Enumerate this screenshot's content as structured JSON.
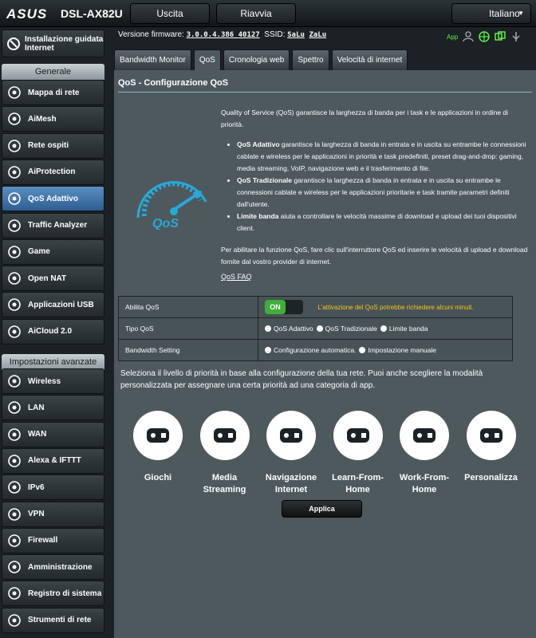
{
  "header": {
    "brand": "ASUS",
    "model": "DSL-AX82U",
    "logout_label": "Uscita",
    "reboot_label": "Riavvia",
    "language": "Italiano"
  },
  "firmware_bar": {
    "firmware_label": "Versione firmware:",
    "firmware_value": "3.0.0.4.386_40127",
    "ssid_label": "SSID:",
    "ssid_1": "SaLu",
    "ssid_2": "ZaLu",
    "app_label": "App"
  },
  "sidebar": {
    "quick_setup": "Installazione guidata Internet",
    "general_header": "Generale",
    "general_items": [
      {
        "label": "Mappa di rete",
        "icon": "network-map-icon"
      },
      {
        "label": "AiMesh",
        "icon": "aimesh-icon"
      },
      {
        "label": "Rete ospiti",
        "icon": "guest-network-icon"
      },
      {
        "label": "AiProtection",
        "icon": "aiprotection-icon"
      },
      {
        "label": "QoS Adattivo",
        "icon": "qos-icon"
      },
      {
        "label": "Traffic Analyzer",
        "icon": "traffic-analyzer-icon"
      },
      {
        "label": "Game",
        "icon": "game-icon"
      },
      {
        "label": "Open NAT",
        "icon": "open-nat-icon"
      },
      {
        "label": "Applicazioni USB",
        "icon": "usb-icon"
      },
      {
        "label": "AiCloud 2.0",
        "icon": "aicloud-icon"
      }
    ],
    "advanced_header": "Impostazioni avanzate",
    "advanced_items": [
      {
        "label": "Wireless",
        "icon": "wireless-icon"
      },
      {
        "label": "LAN",
        "icon": "lan-icon"
      },
      {
        "label": "WAN",
        "icon": "wan-icon"
      },
      {
        "label": "Alexa & IFTTT",
        "icon": "alexa-icon"
      },
      {
        "label": "IPv6",
        "icon": "ipv6-icon"
      },
      {
        "label": "VPN",
        "icon": "vpn-icon"
      },
      {
        "label": "Firewall",
        "icon": "firewall-icon"
      },
      {
        "label": "Amministrazione",
        "icon": "administration-icon"
      },
      {
        "label": "Registro di sistema",
        "icon": "system-log-icon"
      },
      {
        "label": "Strumenti di rete",
        "icon": "network-tools-icon"
      }
    ]
  },
  "tabs": [
    {
      "label": "Bandwidth Monitor"
    },
    {
      "label": "QoS"
    },
    {
      "label": "Cronologia web"
    },
    {
      "label": "Spettro"
    },
    {
      "label": "Velocità di internet"
    }
  ],
  "panel": {
    "title": "QoS - Configurazione QoS",
    "intro": "Quality of Service (QoS) garantisce la larghezza di banda per i task e le applicazioni in ordine di priorità.",
    "bullets": [
      {
        "bold": "QoS Adattivo",
        "text": " garantisce la larghezza di banda in entrata e in uscita su entrambe le connessioni cablate e wireless per le applicazioni in priorità e task predefiniti, preset drag-and-drop: gaming, media streaming, VoIP, navigazione web e il trasferimento di file."
      },
      {
        "bold": "QoS Tradizionale",
        "text": " garantisce la larghezza di banda in entrata e in uscita su entrambe le connessioni cablate e wireless per le applicazioni prioritarie e task tramite parametri definiti dall'utente."
      },
      {
        "bold": "Limite banda",
        "text": " aiuta a controllare le velocità massime di download e upload dei tuoi dispositivi client."
      }
    ],
    "enable_hint": "Per abilitare la funzione QoS, fare clic sull'interruttore QoS ed inserire le velocità di upload e download fornite dal vostro provider di internet.",
    "faq": "QoS FAQ",
    "gauge_text": "QoS"
  },
  "settings": {
    "enable_label": "Abilita QoS",
    "toggle_on": "ON",
    "enable_warning": "L'attivazione del QoS potrebbe richiedere alcuni minuti.",
    "type_label": "Tipo QoS",
    "type_options": [
      "QoS Adattivo",
      "QoS Tradizionale",
      "Limite banda"
    ],
    "type_selected": "QoS Adattivo",
    "bw_label": "Bandwidth Setting",
    "bw_options": [
      "Configurazione automatica.",
      "Impostazione manuale"
    ],
    "bw_selected": "Configurazione automatica."
  },
  "priority": {
    "text": "Seleziona il livello di priorità in base alla configurazione della tua rete. Puoi anche scegliere la modalità personalizzata per assegnare una certa priorità ad una categoria di app.",
    "categories": [
      {
        "label": "Giochi",
        "icon": "gamepad-icon"
      },
      {
        "label": "Media Streaming",
        "icon": "media-streaming-icon"
      },
      {
        "label": "Navigazione Internet",
        "icon": "web-browsing-icon"
      },
      {
        "label": "Learn-From-Home",
        "icon": "learn-from-home-icon"
      },
      {
        "label": "Work-From-Home",
        "icon": "work-from-home-icon"
      },
      {
        "label": "Personalizza",
        "icon": "customize-icon"
      }
    ],
    "apply_label": "Applica"
  }
}
